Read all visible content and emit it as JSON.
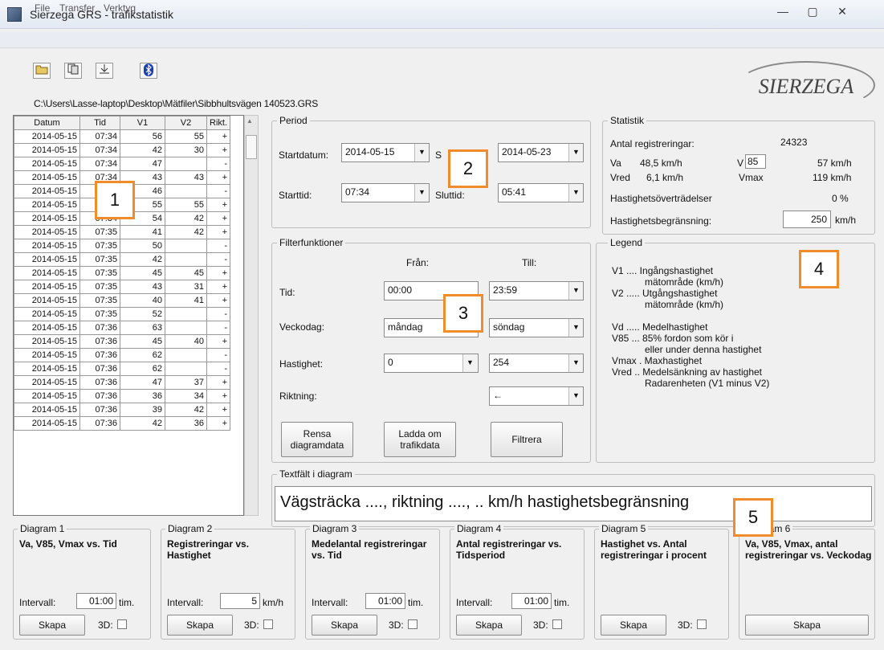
{
  "window": {
    "title": "Sierzega GRS - trafikstatistik",
    "min_glyph": "—",
    "max_glyph": "▢",
    "close_glyph": "✕"
  },
  "menu": [
    "File",
    "Transfer",
    "Verktyg"
  ],
  "toolbar": {
    "icons": [
      "open-folder-icon",
      "copy-icon",
      "transfer-icon",
      "bluetooth-icon"
    ]
  },
  "path": "C:\\Users\\Lasse-laptop\\Desktop\\Mätfiler\\Sibbhultsvägen 140523.GRS",
  "logo_text": "SIERZEGA",
  "table": {
    "headers": [
      "Datum",
      "Tid",
      "V1",
      "V2",
      "Rikt."
    ],
    "rows": [
      [
        "2014-05-15",
        "07:34",
        "56",
        "55",
        "+"
      ],
      [
        "2014-05-15",
        "07:34",
        "42",
        "30",
        "+"
      ],
      [
        "2014-05-15",
        "07:34",
        "47",
        "",
        "-"
      ],
      [
        "2014-05-15",
        "07:34",
        "43",
        "43",
        "+"
      ],
      [
        "2014-05-15",
        "07:34",
        "46",
        "",
        "-"
      ],
      [
        "2014-05-15",
        "07:34",
        "55",
        "55",
        "+"
      ],
      [
        "2014-05-15",
        "07:34",
        "54",
        "42",
        "+"
      ],
      [
        "2014-05-15",
        "07:35",
        "41",
        "42",
        "+"
      ],
      [
        "2014-05-15",
        "07:35",
        "50",
        "",
        "-"
      ],
      [
        "2014-05-15",
        "07:35",
        "42",
        "",
        "-"
      ],
      [
        "2014-05-15",
        "07:35",
        "45",
        "45",
        "+"
      ],
      [
        "2014-05-15",
        "07:35",
        "43",
        "31",
        "+"
      ],
      [
        "2014-05-15",
        "07:35",
        "40",
        "41",
        "+"
      ],
      [
        "2014-05-15",
        "07:35",
        "52",
        "",
        "-"
      ],
      [
        "2014-05-15",
        "07:36",
        "63",
        "",
        "-"
      ],
      [
        "2014-05-15",
        "07:36",
        "45",
        "40",
        "+"
      ],
      [
        "2014-05-15",
        "07:36",
        "62",
        "",
        "-"
      ],
      [
        "2014-05-15",
        "07:36",
        "62",
        "",
        "-"
      ],
      [
        "2014-05-15",
        "07:36",
        "47",
        "37",
        "+"
      ],
      [
        "2014-05-15",
        "07:36",
        "36",
        "34",
        "+"
      ],
      [
        "2014-05-15",
        "07:36",
        "39",
        "42",
        "+"
      ],
      [
        "2014-05-15",
        "07:36",
        "42",
        "36",
        "+"
      ]
    ]
  },
  "period": {
    "title": "Period",
    "startdatum_label": "Startdatum:",
    "startdatum_value": "2014-05-15",
    "slutdatum_label": "S",
    "slutdatum_value": "2014-05-23",
    "starttid_label": "Starttid:",
    "starttid_value": "07:34",
    "sluttid_label": "Sluttid:",
    "sluttid_value": "05:41"
  },
  "statistik": {
    "title": "Statistik",
    "antal_label": "Antal registreringar:",
    "antal_value": "24323",
    "va_label": "Va",
    "va_value": "48,5 km/h",
    "v_label": "V",
    "v_input": "85",
    "v_value": "57 km/h",
    "vred_label": "Vred",
    "vred_value": "6,1 km/h",
    "vmax_label": "Vmax",
    "vmax_value": "119 km/h",
    "over_label": "Hastighetsöverträdelser",
    "over_value": "0 %",
    "beg_label": "Hastighetsbegränsning:",
    "beg_value": "250",
    "beg_unit": "km/h"
  },
  "filter": {
    "title": "Filterfunktioner",
    "fran": "Från:",
    "till": "Till:",
    "tid_label": "Tid:",
    "tid_from": "00:00",
    "tid_to": "23:59",
    "veckodag_label": "Veckodag:",
    "veckodag_from": "måndag",
    "veckodag_to": "söndag",
    "hastighet_label": "Hastighet:",
    "hastighet_from": "0",
    "hastighet_to": "254",
    "riktning_label": "Riktning:",
    "riktning_to": "←",
    "btn_rensa": "Rensa diagramdata",
    "btn_ladda": "Ladda om trafikdata",
    "btn_filtrera": "Filtrera"
  },
  "legend": {
    "title": "Legend",
    "lines": [
      "V1 .... Ingångshastighet",
      "mätområde (km/h)",
      "V2 ..... Utgångshastighet",
      "mätområde (km/h)",
      "Vd ..... Medelhastighet",
      "V85 ... 85% fordon som kör i",
      "eller under denna hastighet",
      "Vmax . Maxhastighet",
      "Vred .. Medelsänkning av hastighet",
      "Radarenheten (V1 minus V2)"
    ]
  },
  "textfalt": {
    "title": "Textfält i diagram",
    "value": "Vägsträcka ...., riktning ...., .. km/h hastighetsbegränsning"
  },
  "diagrams": [
    {
      "title": "Diagram 1",
      "desc": "Va, V85, Vmax vs. Tid",
      "interval_label": "Intervall:",
      "interval_value": "01:00",
      "interval_unit": "tim.",
      "btn": "Skapa",
      "threed": "3D:"
    },
    {
      "title": "Diagram 2",
      "desc": "Registreringar vs. Hastighet",
      "interval_label": "Intervall:",
      "interval_value": "5",
      "interval_unit": "km/h",
      "btn": "Skapa",
      "threed": "3D:"
    },
    {
      "title": "Diagram 3",
      "desc": "Medelantal registreringar vs. Tid",
      "interval_label": "Intervall:",
      "interval_value": "01:00",
      "interval_unit": "tim.",
      "btn": "Skapa",
      "threed": "3D:"
    },
    {
      "title": "Diagram 4",
      "desc": "Antal registreringar vs. Tidsperiod",
      "interval_label": "Intervall:",
      "interval_value": "01:00",
      "interval_unit": "tim.",
      "btn": "Skapa",
      "threed": "3D:"
    },
    {
      "title": "Diagram 5",
      "desc": "Hastighet vs. Antal registreringar i procent",
      "btn": "Skapa",
      "threed": "3D:"
    },
    {
      "title": "Diagram 6",
      "desc": "Va, V85, Vmax, antal registreringar vs. Veckodag",
      "btn": "Skapa"
    }
  ],
  "markers": [
    "1",
    "2",
    "3",
    "4",
    "5"
  ]
}
